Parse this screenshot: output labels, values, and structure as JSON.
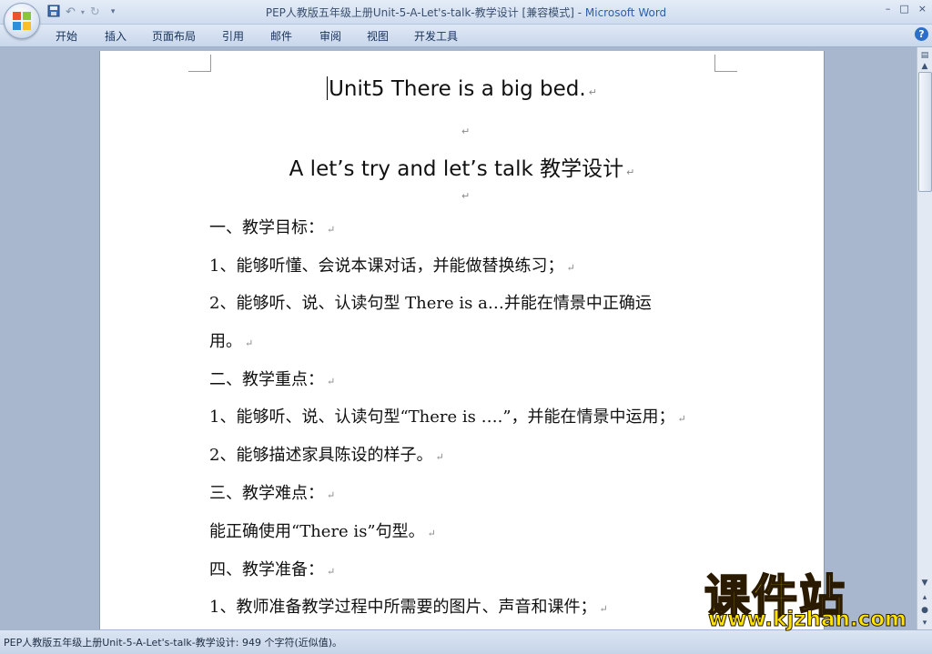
{
  "window": {
    "title": "PEP人教版五年级上册Unit-5-A-Let's-talk-教学设计 [兼容模式]",
    "separator": " - ",
    "app_name": "Microsoft Word",
    "controls": [
      "–",
      "□",
      "×"
    ]
  },
  "ribbon": {
    "tabs": [
      "开始",
      "插入",
      "页面布局",
      "引用",
      "邮件",
      "审阅",
      "视图",
      "开发工具"
    ],
    "help": "?"
  },
  "document": {
    "title": "Unit5 There is a big bed.",
    "subtitle": "A let’s try and let’s talk 教学设计",
    "para_mark": "↵",
    "lines": [
      "一、教学目标：",
      "1、能够听懂、会说本课对话，并能做替换练习；",
      "2、能够听、说、认读句型 There is a…并能在情景中正确运",
      "用。",
      "二、教学重点：",
      "1、能够听、说、认读句型“There is ….”，并能在情景中运用；",
      "2、能够描述家具陈设的样子。",
      "三、教学难点：",
      "能正确使用“There is”句型。",
      "四、教学准备：",
      "1、教师准备教学过程中所需要的图片、声音和课件；"
    ]
  },
  "statusbar": {
    "text": "PEP人教版五年级上册Unit-5-A-Let's-talk-教学设计: 949 个字符(近似值)。"
  },
  "watermark": {
    "brand": "课件站",
    "url": "www.kjzhan.com"
  },
  "colors": {
    "app_name": "#2c5faa",
    "watermark": "#ffe400"
  }
}
